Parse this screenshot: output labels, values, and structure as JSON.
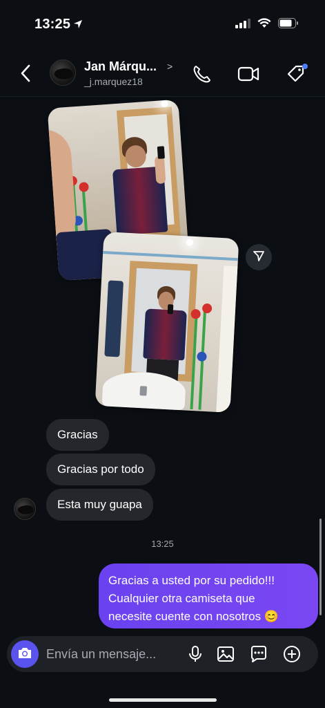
{
  "status_bar": {
    "time": "13:25"
  },
  "header": {
    "name": "Jan Márqu...",
    "chevron": ">",
    "username": "_j.marquez18",
    "icons": [
      "back-icon",
      "phone-icon",
      "video-icon",
      "tag-icon"
    ],
    "notification_dot_color": "#4f7df5"
  },
  "messages": {
    "incoming": [
      {
        "text": "Gracias"
      },
      {
        "text": "Gracias por todo"
      },
      {
        "text": "Esta muy guapa"
      }
    ],
    "timestamp": "13:25",
    "outgoing": {
      "line1": "Gracias a usted por su pedido!!!",
      "line2": "Cualquier otra camiseta que",
      "line3": "necesite cuente con nosotros 😊"
    }
  },
  "composer": {
    "placeholder": "Envía un mensaje...",
    "icons": [
      "camera-icon",
      "microphone-icon",
      "gallery-icon",
      "sticker-icon",
      "plus-icon"
    ],
    "camera_color": "#5b53ee"
  },
  "colors": {
    "background": "#0b0f14",
    "incoming_bubble": "#24272c",
    "outgoing_bubble": "#6a42f0"
  }
}
